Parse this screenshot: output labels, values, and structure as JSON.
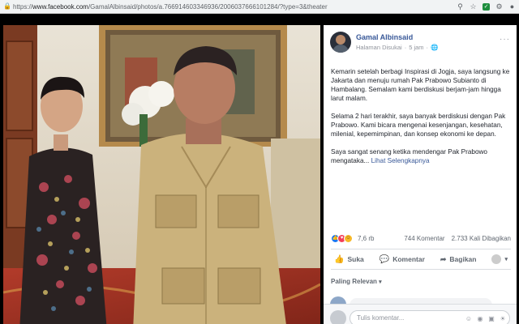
{
  "browser": {
    "url_prefix": "https://",
    "url_domain": "www.facebook.com",
    "url_path": "/GamalAlbinsaid/photos/a.766914603346936/2006037666101284/?type=3&theater"
  },
  "post": {
    "author": "Gamal Albinsaid",
    "page_label": "Halaman Disukai",
    "time": "5 jam",
    "paragraphs": [
      "Kemarin setelah berbagi Inspirasi di Jogja, saya langsung ke Jakarta dan menuju rumah Pak Prabowo Subianto di Hambalang. Semalam kami berdiskusi berjam-jam hingga larut malam.",
      "Selama 2 hari terakhir, saya banyak berdiskusi dengan Pak Prabowo. Kami bicara mengenai kesenjangan, kesehatan, milenial, kepemimpinan, dan konsep ekonomi ke depan."
    ],
    "last_paragraph": "Saya sangat senang ketika mendengar Pak Prabowo mengataka...",
    "see_more": "Lihat Selengkapnya",
    "reactions_count": "7,6 rb",
    "comments_count": "744 Komentar",
    "shares_count": "2.733 Kali Dibagikan",
    "actions": {
      "like": "Suka",
      "comment": "Komentar",
      "share": "Bagikan"
    },
    "sort_label": "Paling Relevan",
    "comment_placeholder": "Tulis komentar..."
  },
  "colors": {
    "link_blue": "#385898",
    "like_blue": "#1877f2",
    "love_red": "#f33e58",
    "haha_yellow": "#f7b928"
  },
  "icons": {
    "lock": "lock-icon",
    "star": "star-icon",
    "extension": "extension-icon",
    "globe": "globe-icon",
    "like": "thumbs-up-icon",
    "comment": "comment-icon",
    "share": "share-icon",
    "emoji": "emoji-icon",
    "camera": "camera-icon",
    "gif": "gif-icon",
    "sticker": "sticker-icon"
  }
}
